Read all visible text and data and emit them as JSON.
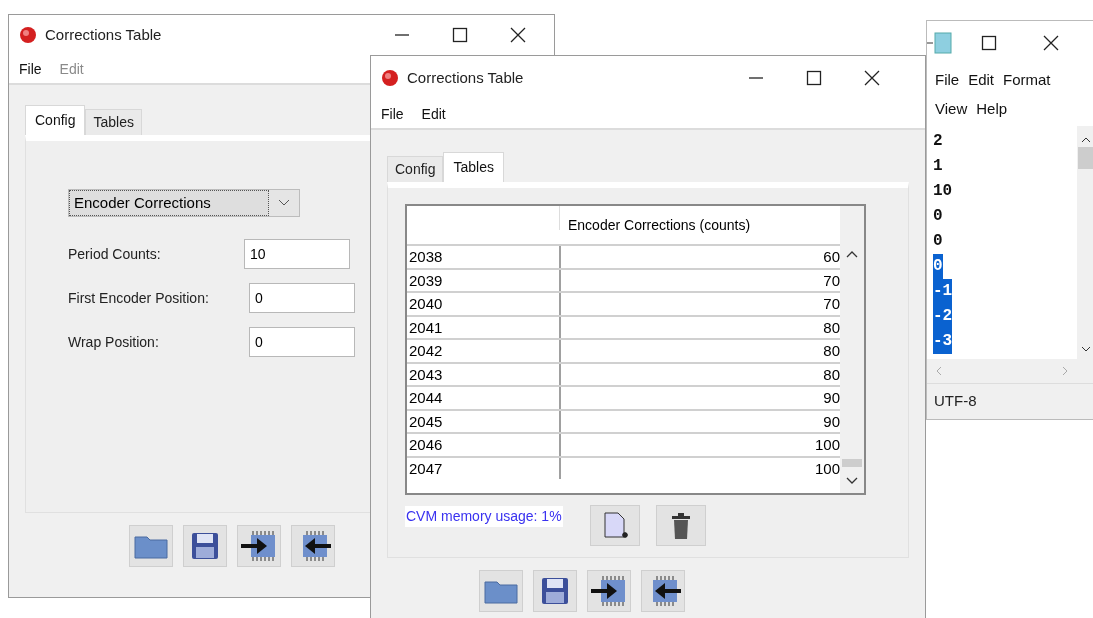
{
  "config_window": {
    "title": "Corrections Table",
    "menu": [
      {
        "label": "File",
        "disabled": false
      },
      {
        "label": "Edit",
        "disabled": true
      }
    ],
    "tabs": [
      {
        "label": "Config",
        "selected": true
      },
      {
        "label": "Tables",
        "selected": false
      }
    ],
    "dropdown": {
      "value": "Encoder Corrections"
    },
    "fields": [
      {
        "label": "Period Counts:",
        "value": "10"
      },
      {
        "label": "First Encoder Position:",
        "value": "0"
      },
      {
        "label": "Wrap Position:",
        "value": "0"
      }
    ],
    "toolbar": [
      {
        "kind": "open"
      },
      {
        "kind": "save"
      },
      {
        "kind": "download"
      },
      {
        "kind": "upload"
      }
    ]
  },
  "tables_window": {
    "title": "Corrections Table",
    "menu": [
      {
        "label": "File",
        "disabled": false
      },
      {
        "label": "Edit",
        "disabled": false
      }
    ],
    "tabs": [
      {
        "label": "Config",
        "selected": false
      },
      {
        "label": "Tables",
        "selected": true
      }
    ],
    "table": {
      "columns": [
        "Encoder Corrections (counts)"
      ],
      "rows": [
        [
          "2038",
          "60"
        ],
        [
          "2039",
          "70"
        ],
        [
          "2040",
          "70"
        ],
        [
          "2041",
          "80"
        ],
        [
          "2042",
          "80"
        ],
        [
          "2043",
          "80"
        ],
        [
          "2044",
          "90"
        ],
        [
          "2045",
          "90"
        ],
        [
          "2046",
          "100"
        ],
        [
          "2047",
          "100"
        ]
      ]
    },
    "memory_usage": "CVM memory usage: 1%",
    "actions": [
      {
        "kind": "new"
      },
      {
        "kind": "delete"
      }
    ],
    "toolbar": [
      {
        "kind": "open"
      },
      {
        "kind": "save"
      },
      {
        "kind": "download"
      },
      {
        "kind": "upload"
      }
    ]
  },
  "notepad": {
    "menu": [
      [
        "File",
        "Edit",
        "Format"
      ],
      [
        "View",
        "Help"
      ]
    ],
    "lines": [
      {
        "text": "2",
        "selected": false
      },
      {
        "text": "1",
        "selected": false
      },
      {
        "text": "10",
        "selected": false
      },
      {
        "text": "0",
        "selected": false
      },
      {
        "text": "0",
        "selected": false
      },
      {
        "text": "0",
        "selected": true
      },
      {
        "text": "-1",
        "selected": true
      },
      {
        "text": "-2",
        "selected": true
      },
      {
        "text": "-3",
        "selected": true
      }
    ],
    "status": "UTF-8"
  }
}
